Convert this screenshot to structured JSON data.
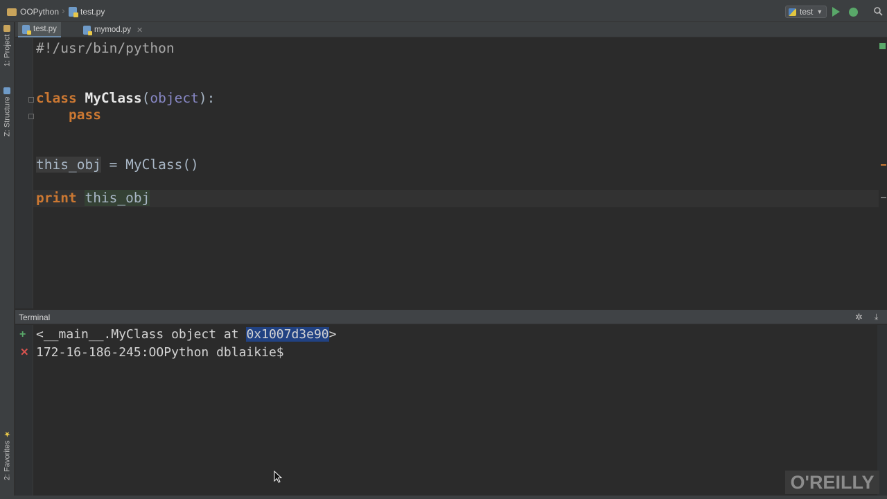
{
  "navbar": {
    "project": "OOPython",
    "file": "test.py",
    "run_config": "test",
    "icons": [
      "folder-icon",
      "python-file-icon",
      "run-icon",
      "debug-icon",
      "search-icon"
    ]
  },
  "sidebar": {
    "project_tab": "1: Project",
    "structure_tab": "Z: Structure",
    "favorites_tab": "2: Favorites"
  },
  "tabs": [
    {
      "label": "test.py",
      "active": true
    },
    {
      "label": "mymod.py",
      "active": false
    }
  ],
  "editor": {
    "lines": {
      "shebang": "#!/usr/bin/python",
      "class_kw": "class",
      "class_name": "MyClass",
      "class_paren_open": "(",
      "class_base": "object",
      "class_paren_close": "):",
      "pass_kw": "pass",
      "assign_var": "this_obj",
      "assign_rest": " = MyClass()",
      "print_kw": "print",
      "print_var": "this_obj"
    }
  },
  "terminal": {
    "title": "Terminal",
    "output_prefix": "<__main__.MyClass object at ",
    "output_address": "0x1007d3e90",
    "output_suffix": ">",
    "prompt": "172-16-186-245:OOPython dblaikie$"
  },
  "watermark": "O'REILLY",
  "colors": {
    "background": "#2b2b2b",
    "keyword": "#cc7832",
    "builtin": "#8888c6",
    "selection": "#214283",
    "run_green": "#59a869"
  }
}
